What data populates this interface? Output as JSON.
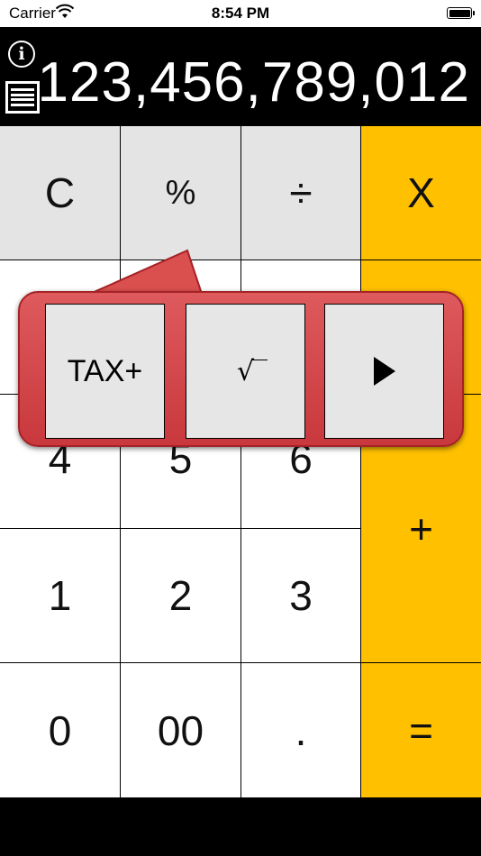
{
  "status_bar": {
    "carrier": "Carrier",
    "time": "8:54 PM"
  },
  "display": {
    "value": "123,456,789,012"
  },
  "icons": {
    "info": "i"
  },
  "keys": {
    "clear": "C",
    "percent": "%",
    "divide": "÷",
    "multiply": "X",
    "four": "4",
    "five": "5",
    "six": "6",
    "plus": "+",
    "one": "1",
    "two": "2",
    "three": "3",
    "zero": "0",
    "double_zero": "00",
    "decimal": ".",
    "equals": "="
  },
  "popup": {
    "tax_plus": "TAX+",
    "sqrt": "√"
  },
  "colors": {
    "operator": "#ffc000",
    "function_key": "#e4e4e4",
    "popup": "#d4474a"
  }
}
